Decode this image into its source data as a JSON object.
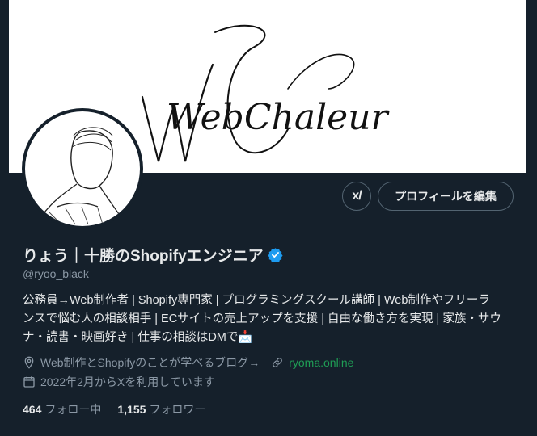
{
  "banner": {
    "logo_text": "WebChaleur"
  },
  "actions": {
    "grok_label": "x/",
    "edit_profile_label": "プロフィールを編集"
  },
  "profile": {
    "display_name": "りょう｜十勝のShopifyエンジニア",
    "handle": "@ryoo_black",
    "bio_lines": [
      "公務員→Web制作者 | Shopify専門家 | プログラミングスクール講師 | Web制作やフリーラ",
      "ンスで悩む人の相談相手 | ECサイトの売上アップを支援 | 自由な働き方を実現 | 家族・サウ",
      "ナ・読書・映画好き | 仕事の相談はDMで📩"
    ],
    "location": "Web制作とShopifyのことが学べるブログ→",
    "website": "ryoma.online",
    "joined": "2022年2月からXを利用しています"
  },
  "stats": {
    "following_count": "464",
    "following_label": "フォロー中",
    "followers_count": "1,155",
    "followers_label": "フォロワー"
  },
  "colors": {
    "background": "#15202b",
    "text_primary": "#e7e9ea",
    "text_secondary": "#8b98a5",
    "verified": "#1d9bf0",
    "website_link": "#1f9d55"
  },
  "icons": [
    "verified-badge-icon",
    "location-icon",
    "link-icon",
    "calendar-icon",
    "envelope-icon"
  ]
}
